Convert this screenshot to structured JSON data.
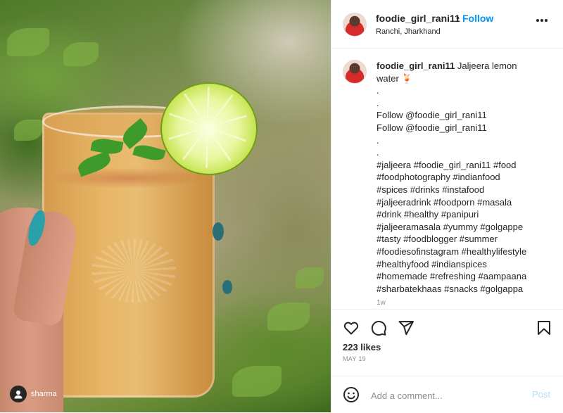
{
  "header": {
    "username": "foodie_girl_rani11",
    "separator": "•",
    "follow_label": "Follow",
    "location": "Ranchi, Jharkhand",
    "more_icon": "more-horizontal-icon"
  },
  "photo": {
    "alt_subject": "jaljeera lemon water glass",
    "overlay_user_label": "sharma"
  },
  "caption": {
    "username": "foodie_girl_rani11",
    "lines": [
      " Jaljeera lemon",
      "water 🍹",
      ".",
      ".",
      "Follow @foodie_girl_rani11",
      "Follow @foodie_girl_rani11",
      ".",
      ".",
      "#jaljeera #foodie_girl_rani11 #food",
      "#foodphotography #indianfood",
      "#spices #drinks #instafood",
      "#jaljeeradrink #foodporn #masala",
      "#drink #healthy #panipuri",
      "#jaljeeramasala #yummy #golgappe",
      "#tasty #foodblogger #summer",
      "#foodiesofinstagram #healthylifestyle",
      "#healthyfood #indianspices",
      "#homemade #refreshing #aampaana",
      "#sharbatekhaas #snacks #golgappa"
    ],
    "time_ago": "1w"
  },
  "actions": {
    "icons": [
      "heart-icon",
      "comment-icon",
      "share-icon",
      "bookmark-icon"
    ],
    "likes": "223 likes",
    "date": "MAY 19"
  },
  "add_comment": {
    "placeholder": "Add a comment...",
    "post_label": "Post"
  },
  "colors": {
    "accent": "#0095f6",
    "post_disabled": "#b2dffc",
    "muted": "#8e8e8e",
    "border": "#efefef"
  }
}
